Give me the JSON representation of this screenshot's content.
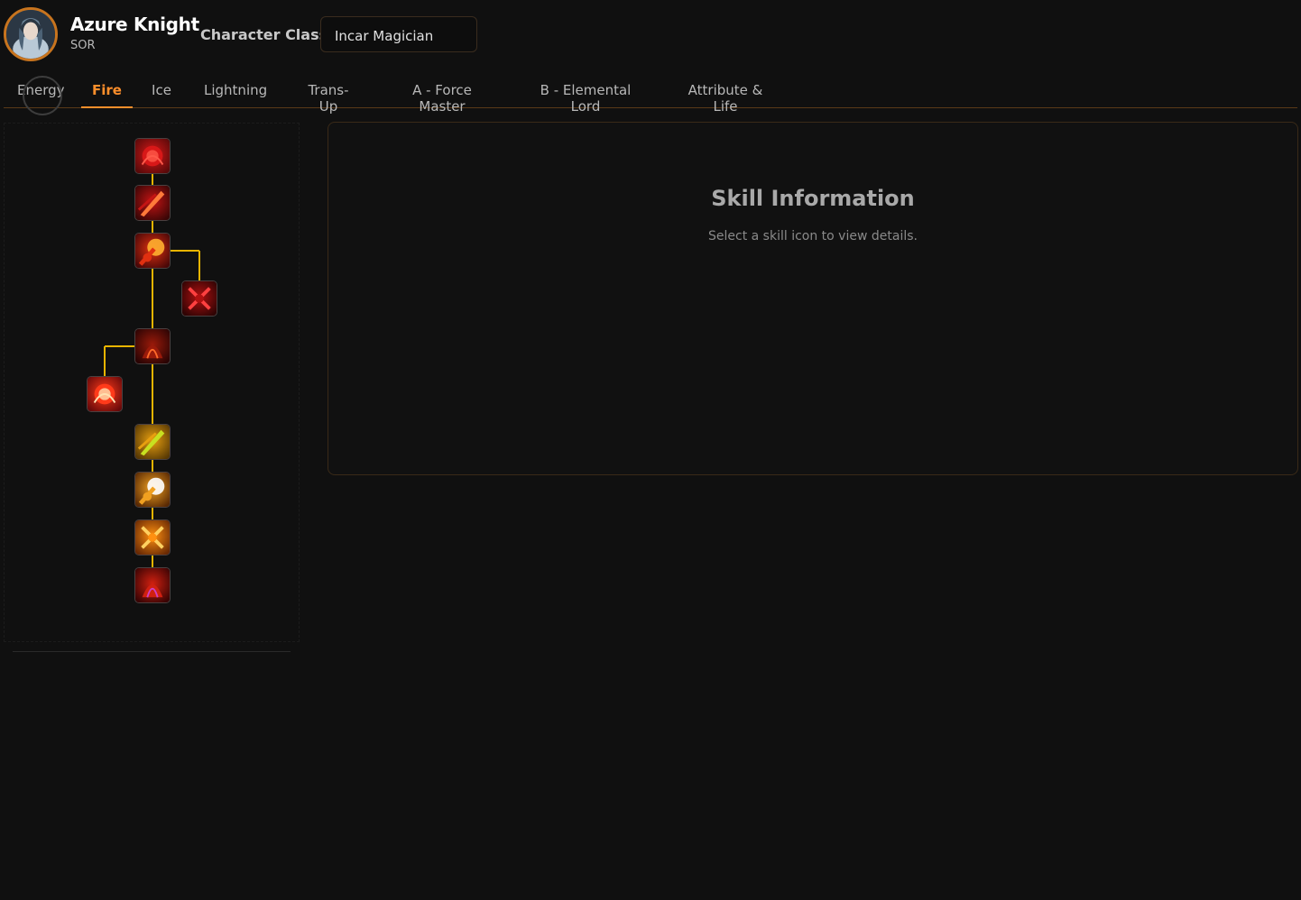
{
  "character": {
    "name": "Azure Knight",
    "class_code": "SOR",
    "class_label": "Character Class",
    "class_value": "Incar Magician"
  },
  "tabs": [
    {
      "label": "Energy",
      "active": false
    },
    {
      "label": "Fire",
      "active": true
    },
    {
      "label": "Ice",
      "active": false
    },
    {
      "label": "Lightning",
      "active": false
    },
    {
      "label": "Trans-Up",
      "active": false
    },
    {
      "label": "A - Force Master",
      "active": false
    },
    {
      "label": "B - Elemental Lord",
      "active": false
    },
    {
      "label": "Attribute & Life",
      "active": false
    }
  ],
  "skill_tree": {
    "connector_color": "#e8b400",
    "nodes": [
      {
        "icon": "fire-rose-icon",
        "palette": [
          "#5a0a0a",
          "#d81818",
          "#ff5a4a"
        ]
      },
      {
        "icon": "fire-slash-icon",
        "palette": [
          "#3a0606",
          "#c41414",
          "#ff7a3a"
        ]
      },
      {
        "icon": "fire-burst-icon",
        "palette": [
          "#4a0808",
          "#e03010",
          "#ffb030"
        ]
      },
      {
        "icon": "crossed-flames-icon",
        "palette": [
          "#300404",
          "#b01010",
          "#ff4040"
        ]
      },
      {
        "icon": "fire-pillar-icon",
        "palette": [
          "#2a0404",
          "#9a1a0a",
          "#ff6a2a"
        ]
      },
      {
        "icon": "fire-orb-icon",
        "palette": [
          "#6a0a0a",
          "#ff3a1a",
          "#ffe0b0"
        ]
      },
      {
        "icon": "fire-dragon-icon",
        "palette": [
          "#5a3a04",
          "#e8a010",
          "#c8e020"
        ]
      },
      {
        "icon": "flame-lightning-icon",
        "palette": [
          "#5a2a04",
          "#f0a020",
          "#ffffff"
        ]
      },
      {
        "icon": "fire-explosion-icon",
        "palette": [
          "#6a2a04",
          "#ff9010",
          "#ffd060"
        ]
      },
      {
        "icon": "fire-spiral-icon",
        "palette": [
          "#3a0404",
          "#d02010",
          "#d040c0"
        ]
      }
    ]
  },
  "info": {
    "title": "Skill Information",
    "hint": "Select a skill icon to view details."
  }
}
